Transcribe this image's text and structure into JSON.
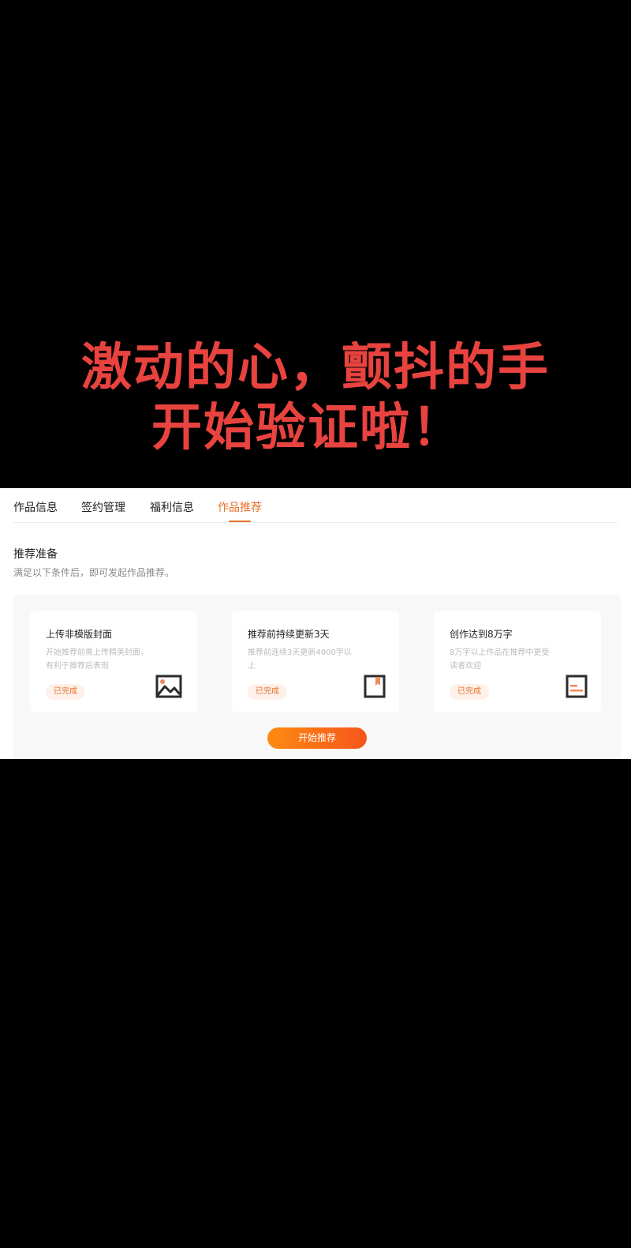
{
  "caption": {
    "line1": "激动的心，颤抖的手",
    "line2": "开始验证啦！"
  },
  "tabs": [
    {
      "label": "作品信息",
      "active": false
    },
    {
      "label": "签约管理",
      "active": false
    },
    {
      "label": "福利信息",
      "active": false
    },
    {
      "label": "作品推荐",
      "active": true
    }
  ],
  "section": {
    "title": "推荐准备",
    "subtitle": "满足以下条件后，即可发起作品推荐。"
  },
  "conditions": [
    {
      "title": "上传非模版封面",
      "desc": "开始推荐前需上传精美封面，有利于推荐后表现",
      "status": "已完成",
      "icon": "image-icon"
    },
    {
      "title": "推荐前持续更新3天",
      "desc": "推荐前连续3天更新4000字以上",
      "status": "已完成",
      "icon": "bookmark-book-icon"
    },
    {
      "title": "创作达到8万字",
      "desc": "8万字以上作品在推荐中更受读者欢迎",
      "status": "已完成",
      "icon": "text-document-icon"
    }
  ],
  "action": {
    "start_label": "开始推荐"
  },
  "colors": {
    "accent": "#e8702a",
    "caption": "#e8433f",
    "button_from": "#ff8a12",
    "button_to": "#f6561b"
  }
}
